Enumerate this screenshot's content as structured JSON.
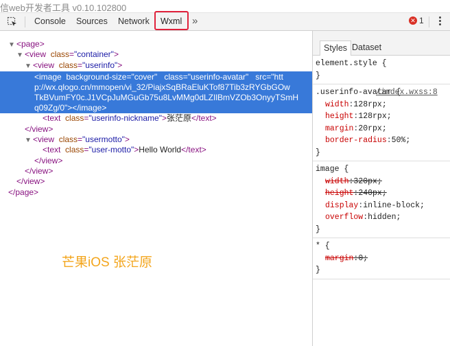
{
  "app": {
    "title": "信web开发者工具 v0.10.102800"
  },
  "toolbar": {
    "tabs": [
      "Console",
      "Sources",
      "Network",
      "Wxml"
    ],
    "active_tab": "Wxml",
    "more": "»",
    "error_count": "1"
  },
  "tree": {
    "page_open": "<page>",
    "view_container_open": "<view",
    "container_class_attr": "class",
    "container_class_val": "\"container\"",
    "view_userinfo_tag": "<view",
    "userinfo_class_val": "\"userinfo\"",
    "image_tag": "<image",
    "image_attr_bg": "background-size",
    "image_attr_bg_val": "\"cover\"",
    "image_attr_class": "class",
    "image_attr_class_val": "\"userinfo-avatar\"",
    "image_attr_src": "src",
    "image_src_line1": "\"htt",
    "image_src_line2": "p://wx.qlogo.cn/mmopen/vi_32/PiajxSqBRaEluKTof87Tib3zRYGbGOw",
    "image_src_line3": "TkBVumFY0c.J1VCpJuMGuGb75u8LvMMg0dLZIlBmVZOb3OnyyTSmH",
    "image_src_line4": "q09Zg/0\"",
    "image_close": "></image>",
    "text_nick_open": "<text",
    "nick_class_val": "\"userinfo-nickname\"",
    "nick_text": "张茫原",
    "text_close": "</text>",
    "view_close": "</view>",
    "motto_class_val": "\"usermotto\"",
    "user_motto_class_val": "\"user-motto\"",
    "motto_text": "Hello World",
    "page_close": "</page>"
  },
  "watermark": "芒果iOS 张茫原",
  "styles": {
    "tabs": [
      "Styles",
      "Dataset"
    ],
    "element_style": "element.style {",
    "brace_close": "}",
    "rule1_selector": ".userinfo-avatar {",
    "rule1_source": "/index.wxss:8",
    "rule1_decls": [
      {
        "prop": "width",
        "val": "128rpx;"
      },
      {
        "prop": "height",
        "val": "128rpx;"
      },
      {
        "prop": "margin",
        "val": "20rpx;"
      },
      {
        "prop": "border-radius",
        "val": "50%;"
      }
    ],
    "rule2_selector": "image {",
    "rule2_decls": [
      {
        "prop": "width",
        "val": "320px;",
        "struck": true
      },
      {
        "prop": "height",
        "val": "240px;",
        "struck": true
      },
      {
        "prop": "display",
        "val": "inline-block;",
        "struck": false
      },
      {
        "prop": "overflow",
        "val": "hidden;",
        "struck": false
      }
    ],
    "rule3_selector": "* {",
    "rule3_decls": [
      {
        "prop": "margin",
        "val": "0;",
        "struck": true
      }
    ]
  },
  "colors": {
    "selection": "#3879d9",
    "highlight_border": "#e0213b",
    "watermark": "#f3a51c"
  }
}
